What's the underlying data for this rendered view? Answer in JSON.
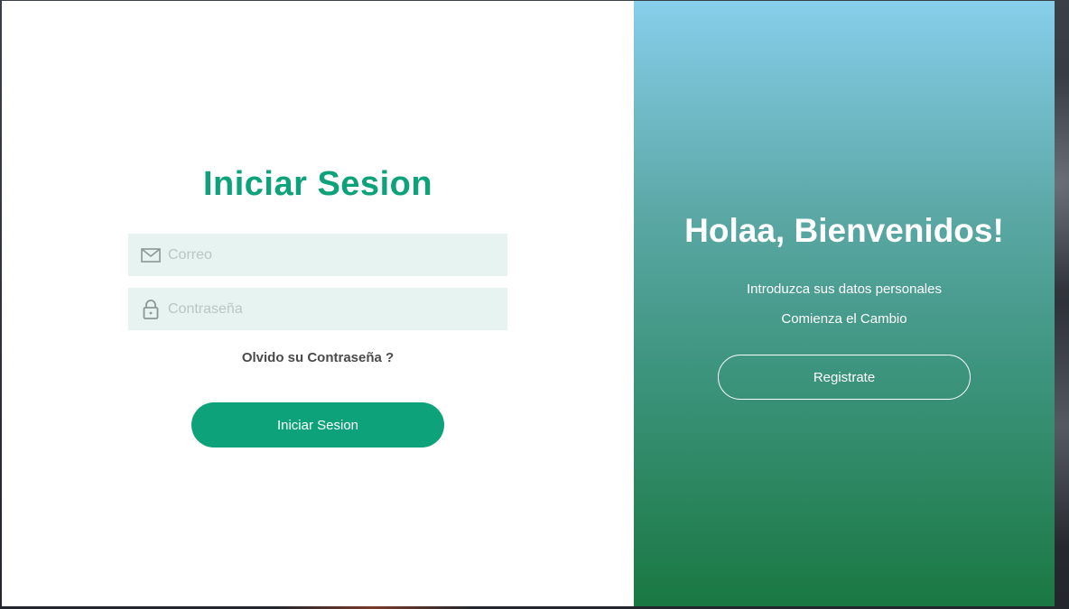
{
  "login": {
    "title": "Iniciar Sesion",
    "email_placeholder": "Correo",
    "email_value": "",
    "password_placeholder": "Contraseña",
    "password_value": "",
    "forgot_password": "Olvido su Contraseña ?",
    "submit_label": "Iniciar Sesion"
  },
  "welcome": {
    "title": "Holaa, Bienvenidos!",
    "line1": "Introduzca sus datos personales",
    "line2": "Comienza el Cambio",
    "register_label": "Registrate"
  },
  "icons": {
    "email": "envelope-icon",
    "password": "lock-icon"
  },
  "colors": {
    "accent": "#0ea27a",
    "field_bg": "#e6f3f0",
    "gradient_top": "#87ceeb",
    "gradient_bottom": "#1a7842"
  }
}
